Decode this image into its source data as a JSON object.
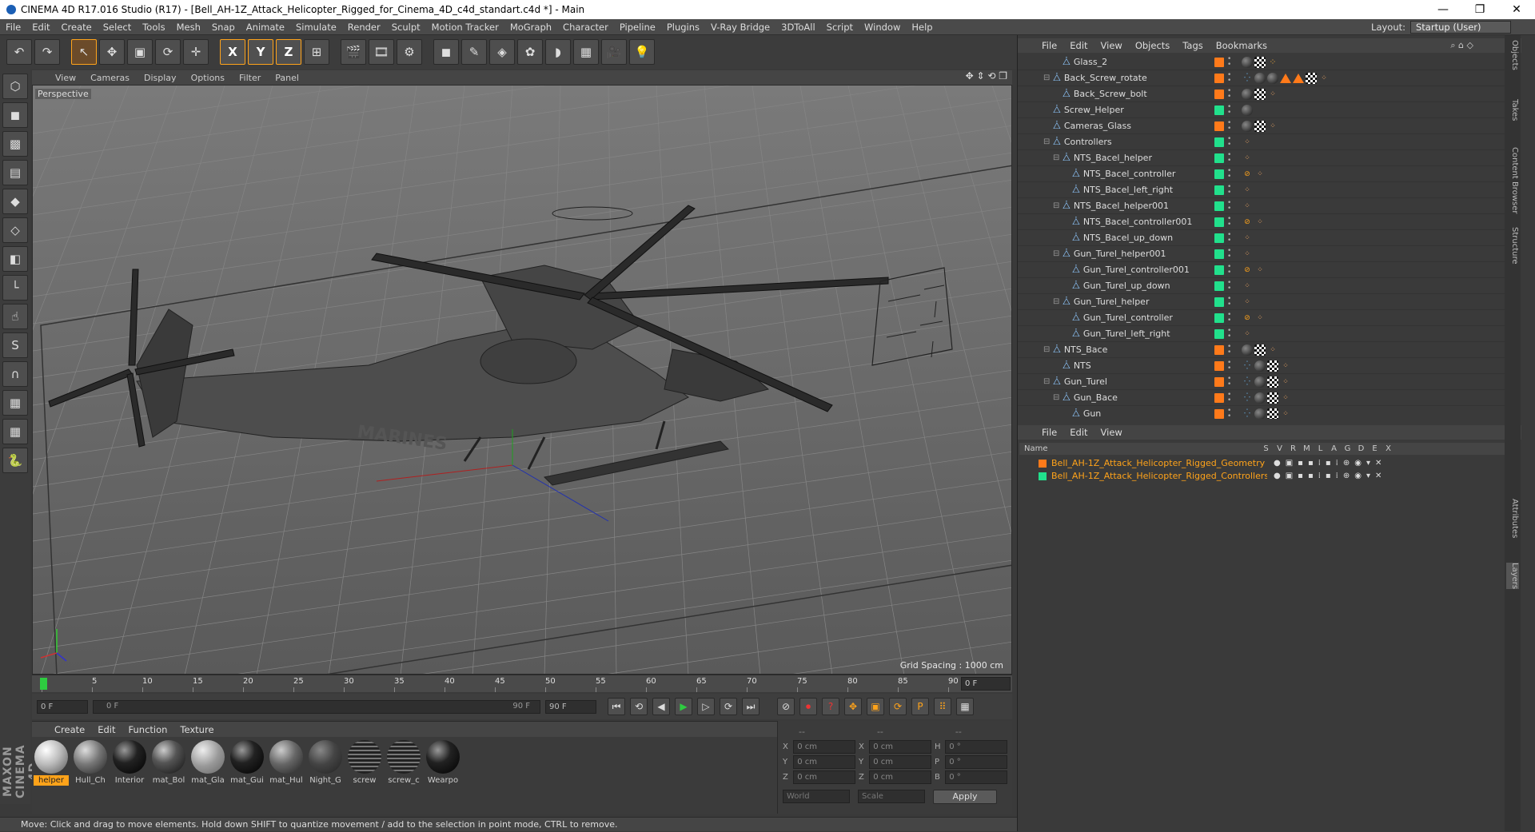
{
  "window": {
    "title": "CINEMA 4D R17.016 Studio (R17) - [Bell_AH-1Z_Attack_Helicopter_Rigged_for_Cinema_4D_c4d_standart.c4d *] - Main",
    "controls": [
      "—",
      "❐",
      "✕"
    ]
  },
  "menubar": {
    "items": [
      "File",
      "Edit",
      "Create",
      "Select",
      "Tools",
      "Mesh",
      "Snap",
      "Animate",
      "Simulate",
      "Render",
      "Sculpt",
      "Motion Tracker",
      "MoGraph",
      "Character",
      "Pipeline",
      "Plugins",
      "V-Ray Bridge",
      "3DToAll",
      "Script",
      "Window",
      "Help"
    ],
    "layout_label": "Layout:",
    "layout_value": "Startup (User)"
  },
  "toolbar": {
    "buttons": [
      {
        "name": "undo-button",
        "glyph": "↶"
      },
      {
        "name": "redo-button",
        "glyph": "↷"
      },
      {
        "name": "live-selection-tool",
        "glyph": "↖",
        "active": true
      },
      {
        "name": "move-tool",
        "glyph": "✥"
      },
      {
        "name": "scale-tool",
        "glyph": "▣"
      },
      {
        "name": "rotate-tool",
        "glyph": "⟳"
      },
      {
        "name": "transform-tool",
        "glyph": "✛"
      },
      {
        "name": "x-axis-lock",
        "glyph": "X"
      },
      {
        "name": "y-axis-lock",
        "glyph": "Y"
      },
      {
        "name": "z-axis-lock",
        "glyph": "Z"
      },
      {
        "name": "coordinate-system",
        "glyph": "⊞"
      },
      {
        "name": "render-view",
        "glyph": "🎬"
      },
      {
        "name": "render-picture-viewer",
        "glyph": "🎞"
      },
      {
        "name": "render-settings",
        "glyph": "⚙"
      },
      {
        "name": "cube-object",
        "glyph": "◼"
      },
      {
        "name": "pen-spline",
        "glyph": "✎"
      },
      {
        "name": "subdivision-nurbs",
        "glyph": "◈"
      },
      {
        "name": "array-mograph",
        "glyph": "✿"
      },
      {
        "name": "deformer",
        "glyph": "◗"
      },
      {
        "name": "floor-scene",
        "glyph": "▦"
      },
      {
        "name": "camera-object",
        "glyph": "🎥"
      },
      {
        "name": "light-object",
        "glyph": "💡"
      }
    ]
  },
  "left_toolbar": {
    "buttons": [
      {
        "name": "make-editable",
        "glyph": "⬡"
      },
      {
        "name": "model-mode",
        "glyph": "◼"
      },
      {
        "name": "texture-mode",
        "glyph": "▩"
      },
      {
        "name": "workplane-mode",
        "glyph": "▤"
      },
      {
        "name": "points-mode",
        "glyph": "◆"
      },
      {
        "name": "edges-mode",
        "glyph": "◇"
      },
      {
        "name": "polygons-mode",
        "glyph": "◧"
      },
      {
        "name": "axis-mode",
        "glyph": "└"
      },
      {
        "name": "tweak-mode",
        "glyph": "☝"
      },
      {
        "name": "snapping",
        "glyph": "S"
      },
      {
        "name": "magnet-tool",
        "glyph": "∩"
      },
      {
        "name": "workplane-lock",
        "glyph": "▦"
      },
      {
        "name": "grid-snap",
        "glyph": "▦"
      },
      {
        "name": "python-script",
        "glyph": "🐍"
      }
    ],
    "brand": "MAXON CINEMA 4D"
  },
  "viewport": {
    "menu": [
      "View",
      "Cameras",
      "Display",
      "Options",
      "Filter",
      "Panel"
    ],
    "nav_icons": "✥ ⇕ ⟲ ❐",
    "camera_name": "Perspective",
    "grid_spacing": "Grid Spacing : 1000 cm",
    "fuselage_text": "MARINES"
  },
  "timeline": {
    "ticks": [
      "0",
      "5",
      "10",
      "15",
      "20",
      "25",
      "30",
      "35",
      "40",
      "45",
      "50",
      "55",
      "60",
      "65",
      "70",
      "75",
      "80",
      "85",
      "90"
    ],
    "current_frame": "0 F",
    "start_field": "0 F",
    "range_start": "0 F",
    "range_end": "90 F",
    "end_field": "90 F"
  },
  "transport": {
    "buttons": [
      "⏮",
      "⟲",
      "◀",
      "▶",
      "▷",
      "⟳",
      "⏭"
    ],
    "key_buttons": [
      "⊘",
      "⏺",
      "?",
      "✥",
      "▣",
      "⟳",
      "P",
      "⠿",
      "▦"
    ]
  },
  "material_manager": {
    "menu": [
      "Create",
      "Edit",
      "Function",
      "Texture"
    ],
    "materials": [
      {
        "label": "helper",
        "style": "helper",
        "selected": true
      },
      {
        "label": "Hull_Ch",
        "style": "grey"
      },
      {
        "label": "Interior",
        "style": "black"
      },
      {
        "label": "mat_Bol",
        "style": "darkgrey"
      },
      {
        "label": "mat_Gla",
        "style": "glass"
      },
      {
        "label": "mat_Gui",
        "style": "black"
      },
      {
        "label": "mat_Hul",
        "style": "grey2"
      },
      {
        "label": "Night_G",
        "style": "dark2"
      },
      {
        "label": "screw",
        "style": "screw"
      },
      {
        "label": "screw_c",
        "style": "screw"
      },
      {
        "label": "Wearpo",
        "style": "black"
      }
    ]
  },
  "coordinates": {
    "header": [
      "--",
      "--",
      "--"
    ],
    "rows": [
      {
        "a": "X",
        "av": "0 cm",
        "b": "X",
        "bv": "0 cm",
        "c": "H",
        "cv": "0 °"
      },
      {
        "a": "Y",
        "av": "0 cm",
        "b": "Y",
        "bv": "0 cm",
        "c": "P",
        "cv": "0 °"
      },
      {
        "a": "Z",
        "av": "0 cm",
        "b": "Z",
        "bv": "0 cm",
        "c": "B",
        "cv": "0 °"
      }
    ],
    "mode_world": "World",
    "mode_scale": "Scale",
    "apply": "Apply"
  },
  "status": "Move: Click and drag to move elements. Hold down SHIFT to quantize movement / add to the selection in point mode, CTRL to remove.",
  "object_manager": {
    "menu": [
      "File",
      "Edit",
      "View",
      "Objects",
      "Tags",
      "Bookmarks"
    ],
    "objects": [
      {
        "name": "Glass_2",
        "indent": 2,
        "color": "#ff7a1a",
        "tags": [
          "mat",
          "k",
          "t"
        ]
      },
      {
        "name": "Back_Screw_rotate",
        "indent": 1,
        "color": "#ff7a1a",
        "tags": [
          "dotg",
          "mat",
          "mat",
          "tri",
          "tri",
          "k",
          "n"
        ]
      },
      {
        "name": "Back_Screw_bolt",
        "indent": 2,
        "color": "#ff7a1a",
        "tags": [
          "mat",
          "k",
          "n"
        ]
      },
      {
        "name": "Screw_Helper",
        "indent": 1,
        "color": "#21e08c",
        "tags": [
          "mat"
        ]
      },
      {
        "name": "Cameras_Glass",
        "indent": 1,
        "color": "#ff7a1a",
        "tags": [
          "mat",
          "k",
          "n"
        ]
      },
      {
        "name": "Controllers",
        "indent": 1,
        "color": "#21e08c",
        "tags": [
          "n"
        ]
      },
      {
        "name": "NTS_Bacel_helper",
        "indent": 2,
        "color": "#21e08c",
        "tags": [
          "n"
        ]
      },
      {
        "name": "NTS_Bacel_controller",
        "indent": 3,
        "color": "#21e08c",
        "tags": [
          "ban",
          "n"
        ]
      },
      {
        "name": "NTS_Bacel_left_right",
        "indent": 3,
        "color": "#21e08c",
        "tags": [
          "n"
        ]
      },
      {
        "name": "NTS_Bacel_helper001",
        "indent": 2,
        "color": "#21e08c",
        "tags": [
          "n"
        ]
      },
      {
        "name": "NTS_Bacel_controller001",
        "indent": 3,
        "color": "#21e08c",
        "tags": [
          "ban",
          "n"
        ]
      },
      {
        "name": "NTS_Bacel_up_down",
        "indent": 3,
        "color": "#21e08c",
        "tags": [
          "n"
        ]
      },
      {
        "name": "Gun_Turel_helper001",
        "indent": 2,
        "color": "#21e08c",
        "tags": [
          "n"
        ]
      },
      {
        "name": "Gun_Turel_controller001",
        "indent": 3,
        "color": "#21e08c",
        "tags": [
          "ban",
          "n"
        ]
      },
      {
        "name": "Gun_Turel_up_down",
        "indent": 3,
        "color": "#21e08c",
        "tags": [
          "n"
        ]
      },
      {
        "name": "Gun_Turel_helper",
        "indent": 2,
        "color": "#21e08c",
        "tags": [
          "n"
        ]
      },
      {
        "name": "Gun_Turel_controller",
        "indent": 3,
        "color": "#21e08c",
        "tags": [
          "ban",
          "n"
        ]
      },
      {
        "name": "Gun_Turel_left_right",
        "indent": 3,
        "color": "#21e08c",
        "tags": [
          "n"
        ]
      },
      {
        "name": "NTS_Bace",
        "indent": 1,
        "color": "#ff7a1a",
        "tags": [
          "mat",
          "k",
          "n"
        ]
      },
      {
        "name": "NTS",
        "indent": 2,
        "color": "#ff7a1a",
        "tags": [
          "dotg",
          "mat",
          "k",
          "n"
        ]
      },
      {
        "name": "Gun_Turel",
        "indent": 1,
        "color": "#ff7a1a",
        "tags": [
          "dotg",
          "mat",
          "k",
          "n"
        ]
      },
      {
        "name": "Gun_Bace",
        "indent": 2,
        "color": "#ff7a1a",
        "tags": [
          "dotg",
          "mat",
          "k",
          "n"
        ]
      },
      {
        "name": "Gun",
        "indent": 3,
        "color": "#ff7a1a",
        "tags": [
          "dotg",
          "mat",
          "k",
          "n"
        ]
      }
    ]
  },
  "layer_manager": {
    "menu": [
      "File",
      "Edit",
      "View"
    ],
    "columns": [
      "Name",
      "S",
      "V",
      "R",
      "M",
      "L",
      "A",
      "G",
      "D",
      "E",
      "X"
    ],
    "layers": [
      {
        "name": "Bell_AH-1Z_Attack_Helicopter_Rigged_Geometry",
        "color": "#ff7a1a"
      },
      {
        "name": "Bell_AH-1Z_Attack_Helicopter_Rigged_Controllers",
        "color": "#21e08c"
      }
    ]
  },
  "side_tabs": [
    "Objects",
    "Takes",
    "Content Browser",
    "Structure",
    "Attributes",
    "Layers"
  ]
}
